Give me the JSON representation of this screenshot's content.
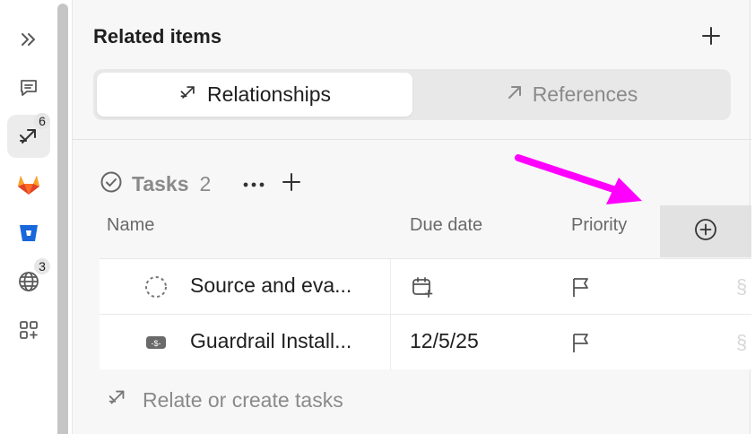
{
  "rail": {
    "items": [
      {
        "icon": "double-chevron-right-icon"
      },
      {
        "icon": "comment-icon"
      },
      {
        "icon": "relationships-icon",
        "badge": "6",
        "active": true
      },
      {
        "icon": "gitlab-icon"
      },
      {
        "icon": "bitbucket-icon"
      },
      {
        "icon": "globe-icon",
        "badge": "3"
      },
      {
        "icon": "apps-plus-icon"
      }
    ]
  },
  "panel": {
    "title": "Related items",
    "tabs": [
      {
        "label": "Relationships",
        "active": true
      },
      {
        "label": "References",
        "active": false
      }
    ],
    "section": {
      "title": "Tasks",
      "count": "2",
      "columns": [
        "Name",
        "Due date",
        "Priority"
      ],
      "rows": [
        {
          "status_icon": "dashed-circle-icon",
          "name": "Source and eva...",
          "due": "",
          "due_icon": "calendar-plus-icon",
          "priority_icon": "flag-icon"
        },
        {
          "status_icon": "money-icon",
          "name": "Guardrail Install...",
          "due": "12/5/25",
          "priority_icon": "flag-icon"
        }
      ],
      "relate_label": "Relate or create tasks"
    }
  },
  "annotation": {
    "color": "#ff00ff"
  }
}
